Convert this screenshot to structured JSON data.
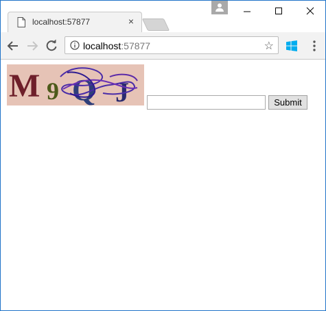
{
  "browser": {
    "tab_title": "localhost:57877",
    "tab_close": "×",
    "address": {
      "host": "localhost",
      "port": ":57877"
    },
    "star": "☆"
  },
  "page": {
    "captcha": {
      "characters": [
        "M",
        "9",
        "Q",
        "J"
      ],
      "colors": [
        "#6e1f2a",
        "#4d5a1a",
        "#2f3f7a",
        "#2a2a6e"
      ]
    },
    "answer_value": "",
    "submit_label": "Submit"
  }
}
